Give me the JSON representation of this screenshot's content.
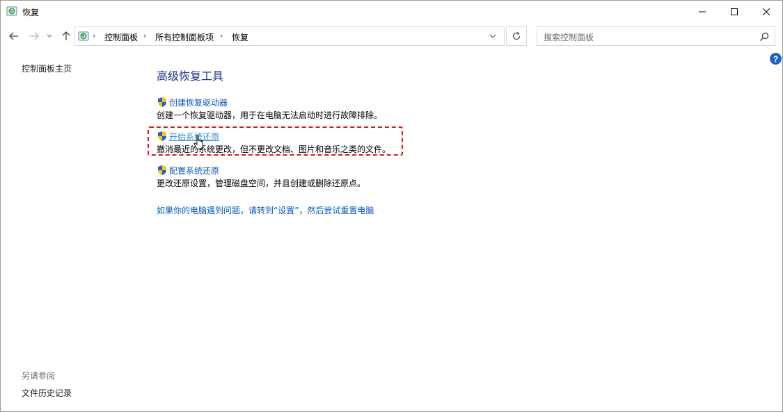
{
  "window": {
    "title": "恢复",
    "icon": "recovery-icon",
    "controls": [
      "minimize-icon",
      "maximize-icon",
      "close-icon"
    ]
  },
  "nav": {
    "back_icon": "arrow-left-icon",
    "forward_icon": "arrow-right-icon",
    "history_icon": "chevron-down-icon",
    "up_icon": "arrow-up-icon",
    "breadcrumbs": [
      "控制面板",
      "所有控制面板项",
      "恢复"
    ],
    "refresh_icon": "refresh-icon"
  },
  "search": {
    "placeholder": "搜索控制面板"
  },
  "help": {
    "label": "?"
  },
  "sidebar": {
    "home": "控制面板主页",
    "see_also_title": "另请参阅",
    "see_also_items": [
      "文件历史记录"
    ]
  },
  "main": {
    "heading": "高级恢复工具",
    "items": [
      {
        "link": "创建恢复驱动器",
        "desc": "创建一个恢复驱动器，用于在电脑无法启动时进行故障排除。",
        "icon": "uac-shield-icon"
      },
      {
        "link": "开始系统还原",
        "desc": "撤消最近的系统更改，但不更改文档、图片和音乐之类的文件。",
        "icon": "uac-shield-icon"
      },
      {
        "link": "配置系统还原",
        "desc": "更改还原设置，管理磁盘空间，并且创建或删除还原点。",
        "icon": "uac-shield-icon"
      }
    ],
    "settings_link": "如果你的电脑遇到问题，请转到“设置”，然后尝试重置电脑"
  },
  "colors": {
    "heading": "#1e3287",
    "link": "#0b57b7",
    "highlight": "#e0141e",
    "help": "#1c64c8"
  }
}
